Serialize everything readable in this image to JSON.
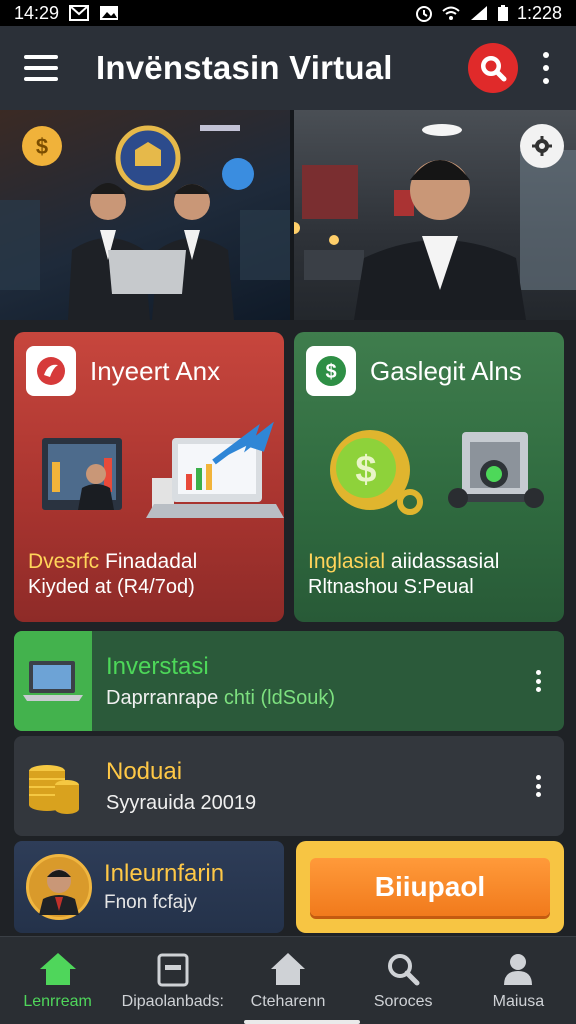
{
  "status_bar": {
    "time": "14:29",
    "right_time": "1:228",
    "icons": [
      "mail-icon",
      "image-icon",
      "alarm-icon",
      "wifi-icon",
      "signal-icon",
      "battery-icon"
    ]
  },
  "app_bar": {
    "title": "Invënstasin Virtual",
    "search_color": "#e02a2a"
  },
  "cards": [
    {
      "title": "Inyeert Anx",
      "sub1_hl": "Dvesrfc",
      "sub1_rest": " Finadadal",
      "sub2": "Kiyded at (R4/7od)",
      "color": "#c7463d"
    },
    {
      "title": "Gaslegit Alns",
      "sub1_hl": "Inglasial",
      "sub1_rest": " aiidassasial",
      "sub2": "Rltnashou S:Peual",
      "color": "#3f7d4d"
    }
  ],
  "list_items": [
    {
      "title": "Inverstasi",
      "sub_a": "Daprranrape ",
      "sub_b": "chti (ldSouk)"
    },
    {
      "title": "Noduai",
      "sub": "Syyrauida 20019"
    }
  ],
  "profile_card": {
    "title": "Inleurnfarin",
    "sub": "Fnon fcfajy"
  },
  "action_button": {
    "label": "Biiupaol"
  },
  "bottom_nav": [
    {
      "label": "Lenrream",
      "icon": "home-icon",
      "active": true
    },
    {
      "label": "Dipaolanbads:",
      "icon": "wallet-icon",
      "active": false
    },
    {
      "label": "Cteharenn",
      "icon": "house-icon",
      "active": false
    },
    {
      "label": "Soroces",
      "icon": "search-icon",
      "active": false
    },
    {
      "label": "Maiusa",
      "icon": "user-icon",
      "active": false
    }
  ],
  "colors": {
    "accent_green": "#4fd65b",
    "accent_gold": "#ffc846",
    "accent_red": "#e02a2a",
    "action_orange": "#f17a1c"
  }
}
